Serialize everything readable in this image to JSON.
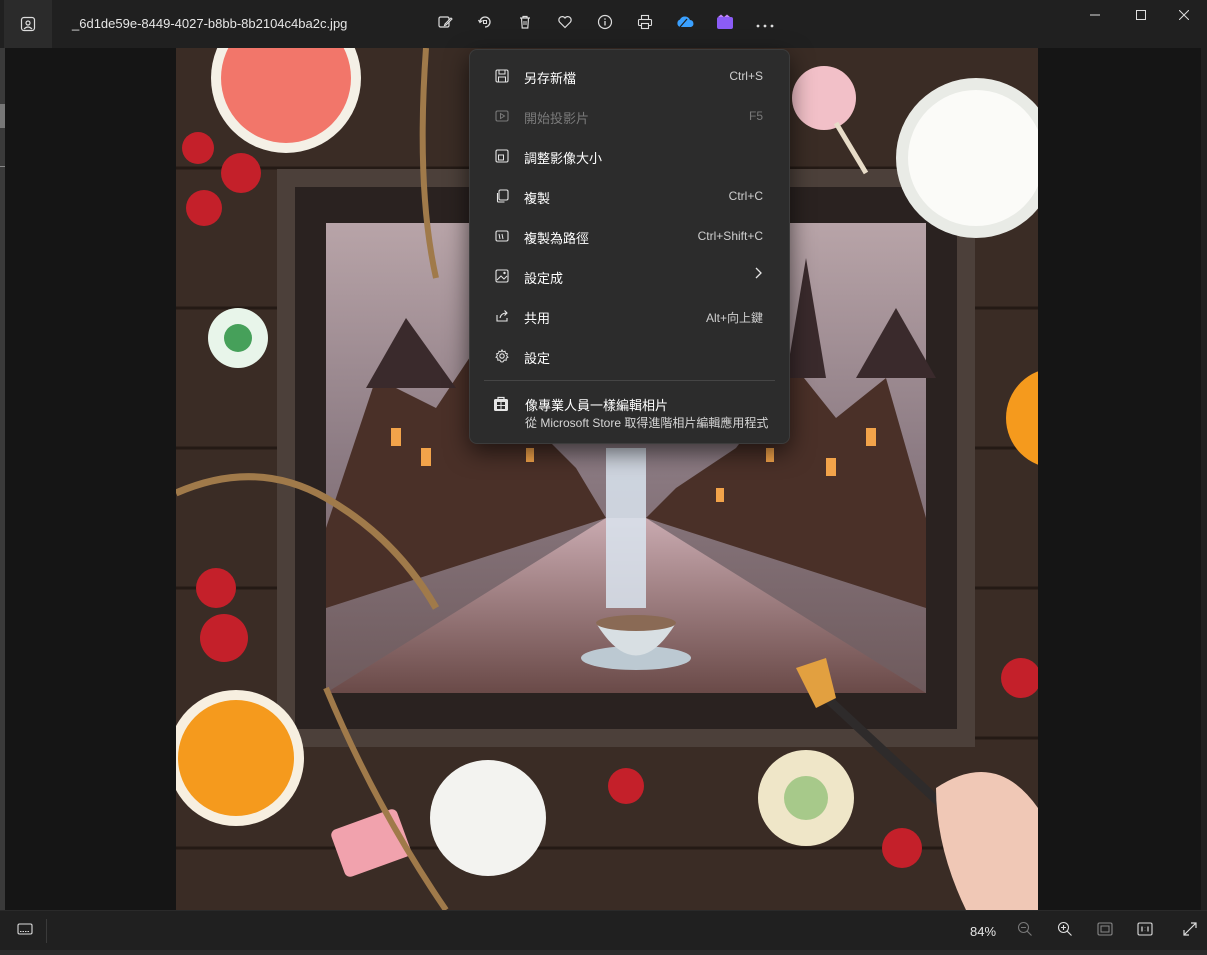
{
  "window": {
    "filename": "_6d1de59e-8449-4027-b8bb-8b2104c4ba2c.jpg"
  },
  "toolbar": {
    "icons": [
      "edit-image-icon",
      "rotate-icon",
      "delete-icon",
      "favorite-icon",
      "info-icon",
      "print-icon",
      "onedrive-icon",
      "clipchamp-icon",
      "more-icon"
    ]
  },
  "context_menu": {
    "items": [
      {
        "label": "另存新檔",
        "shortcut": "Ctrl+S",
        "icon": "save-icon",
        "enabled": true
      },
      {
        "label": "開始投影片",
        "shortcut": "F5",
        "icon": "slideshow-icon",
        "enabled": false
      },
      {
        "label": "調整影像大小",
        "shortcut": "",
        "icon": "resize-icon",
        "enabled": true
      },
      {
        "label": "複製",
        "shortcut": "Ctrl+C",
        "icon": "copy-icon",
        "enabled": true
      },
      {
        "label": "複製為路徑",
        "shortcut": "Ctrl+Shift+C",
        "icon": "copy-path-icon",
        "enabled": true
      },
      {
        "label": "設定成",
        "shortcut": "",
        "icon": "set-as-icon",
        "enabled": true
      },
      {
        "label": "共用",
        "shortcut": "Alt+向上鍵",
        "icon": "share-icon",
        "enabled": true
      },
      {
        "label": "設定",
        "shortcut": "",
        "icon": "settings-icon",
        "enabled": true
      }
    ],
    "promo": {
      "title": "像專業人員一樣編輯相片",
      "subtitle": "從 Microsoft Store 取得進階相片編輯應用程式"
    }
  },
  "statusbar": {
    "zoom": "84%"
  },
  "colors": {
    "background": "#202020",
    "menu": "#2c2c2c",
    "onedrive": "#3aa0ff",
    "clipchamp": "#8b5cf6"
  }
}
